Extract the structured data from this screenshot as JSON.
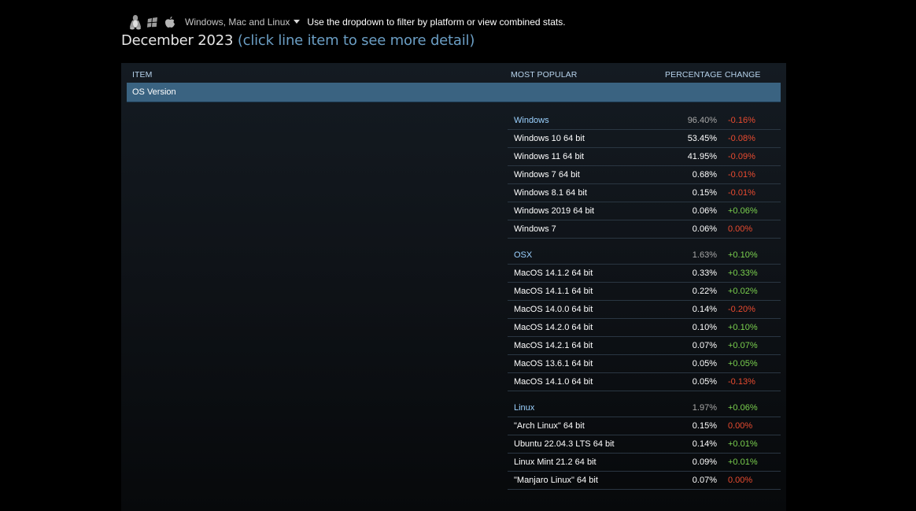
{
  "platform_filter": {
    "icons": [
      "linux-penguin-icon",
      "windows-logo-icon",
      "apple-logo-icon"
    ],
    "selected": "Windows, Mac and Linux",
    "hint": "Use the dropdown to filter by platform or view combined stats."
  },
  "heading": {
    "date": "December 2023",
    "hint": "(click line item to see more detail)"
  },
  "columns": {
    "item": "ITEM",
    "most_popular": "MOST POPULAR",
    "percentage": "PERCENTAGE",
    "change": "CHANGE"
  },
  "section": {
    "title": "OS Version"
  },
  "colors": {
    "negative": "#e94b30",
    "positive": "#7ad04e",
    "section_bar": "#3a6381",
    "link": "#6b9ec4"
  },
  "groups": [
    {
      "head": {
        "name": "Windows",
        "pct": "96.40%",
        "change": "-0.16%"
      },
      "rows": [
        {
          "name": "Windows 10 64 bit",
          "pct": "53.45%",
          "change": "-0.08%"
        },
        {
          "name": "Windows 11 64 bit",
          "pct": "41.95%",
          "change": "-0.09%"
        },
        {
          "name": "Windows 7 64 bit",
          "pct": "0.68%",
          "change": "-0.01%"
        },
        {
          "name": "Windows 8.1 64 bit",
          "pct": "0.15%",
          "change": "-0.01%"
        },
        {
          "name": "Windows 2019 64 bit",
          "pct": "0.06%",
          "change": "+0.06%"
        },
        {
          "name": "Windows 7",
          "pct": "0.06%",
          "change": "0.00%"
        }
      ]
    },
    {
      "head": {
        "name": "OSX",
        "pct": "1.63%",
        "change": "+0.10%"
      },
      "rows": [
        {
          "name": "MacOS 14.1.2 64 bit",
          "pct": "0.33%",
          "change": "+0.33%"
        },
        {
          "name": "MacOS 14.1.1 64 bit",
          "pct": "0.22%",
          "change": "+0.02%"
        },
        {
          "name": "MacOS 14.0.0 64 bit",
          "pct": "0.14%",
          "change": "-0.20%"
        },
        {
          "name": "MacOS 14.2.0 64 bit",
          "pct": "0.10%",
          "change": "+0.10%"
        },
        {
          "name": "MacOS 14.2.1 64 bit",
          "pct": "0.07%",
          "change": "+0.07%"
        },
        {
          "name": "MacOS 13.6.1 64 bit",
          "pct": "0.05%",
          "change": "+0.05%"
        },
        {
          "name": "MacOS 14.1.0 64 bit",
          "pct": "0.05%",
          "change": "-0.13%"
        }
      ]
    },
    {
      "head": {
        "name": "Linux",
        "pct": "1.97%",
        "change": "+0.06%"
      },
      "rows": [
        {
          "name": "\"Arch Linux\" 64 bit",
          "pct": "0.15%",
          "change": "0.00%"
        },
        {
          "name": "Ubuntu 22.04.3 LTS 64 bit",
          "pct": "0.14%",
          "change": "+0.01%"
        },
        {
          "name": "Linux Mint 21.2 64 bit",
          "pct": "0.09%",
          "change": "+0.01%"
        },
        {
          "name": "\"Manjaro Linux\" 64 bit",
          "pct": "0.07%",
          "change": "0.00%"
        }
      ]
    }
  ]
}
